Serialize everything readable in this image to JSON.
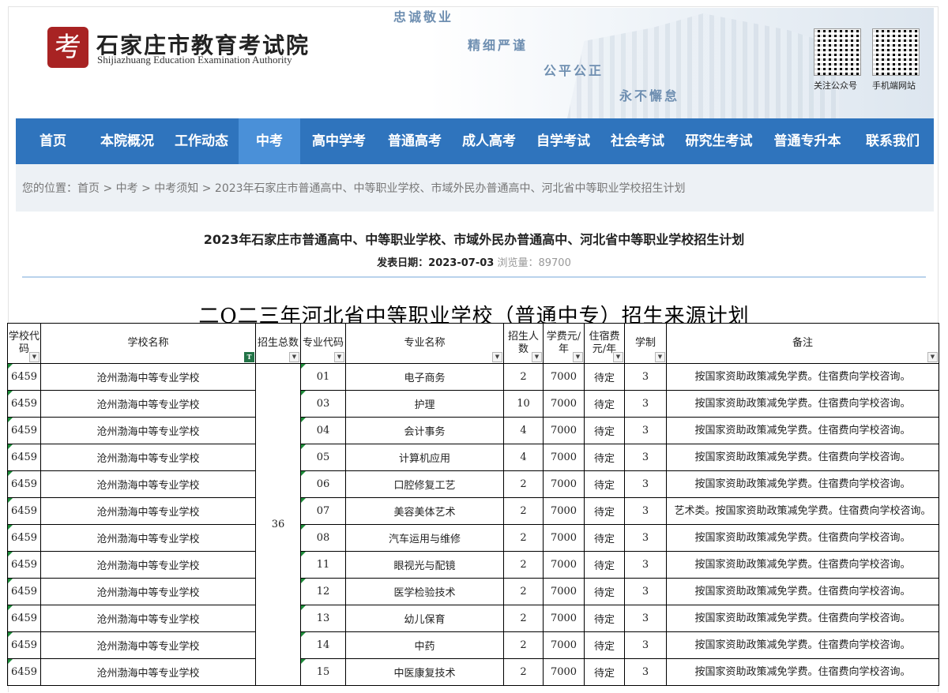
{
  "header": {
    "logo_mark": "考",
    "org_cn": "石家庄市教育考试院",
    "org_en": "Shijiazhuang Education Examination Authority",
    "slogans": [
      "忠诚敬业",
      "精细严谨",
      "公平公正",
      "永不懈怠"
    ],
    "qr_labels": [
      "关注公众号",
      "手机端网站"
    ]
  },
  "nav": {
    "items": [
      "首页",
      "本院概况",
      "工作动态",
      "中考",
      "高中学考",
      "普通高考",
      "成人高考",
      "自学考试",
      "社会考试",
      "研究生考试",
      "普通专升本",
      "联系我们"
    ],
    "active": "中考"
  },
  "breadcrumb": {
    "prefix": "您的位置：",
    "items": [
      "首页",
      "中考",
      "中考须知",
      "2023年石家庄市普通高中、中等职业学校、市域外民办普通高中、河北省中等职业学校招生计划"
    ],
    "separator": " > "
  },
  "article": {
    "title": "2023年石家庄市普通高中、中等职业学校、市域外民办普通高中、河北省中等职业学校招生计划",
    "date_label": "发表日期：",
    "date": "2023-07-03",
    "views_label": "浏览量：",
    "views": "89700"
  },
  "sheet": {
    "title": "二О二三年河北省中等职业学校（普通中专）招生来源计划",
    "headers": [
      "学校代码",
      "学校名称",
      "招生总数",
      "专业代码",
      "专业名称",
      "招生人数",
      "学费元/年",
      "住宿费元/年",
      "学制",
      "备注"
    ],
    "school_code": "6459",
    "school_name": "沧州渤海中等专业学校",
    "total": "36",
    "rows": [
      {
        "code": "01",
        "major": "电子商务",
        "count": "2",
        "tuition": "7000",
        "lodging": "待定",
        "years": "3",
        "note": "按国家资助政策减免学费。住宿费向学校咨询。"
      },
      {
        "code": "03",
        "major": "护理",
        "count": "10",
        "tuition": "7000",
        "lodging": "待定",
        "years": "3",
        "note": "按国家资助政策减免学费。住宿费向学校咨询。"
      },
      {
        "code": "04",
        "major": "会计事务",
        "count": "4",
        "tuition": "7000",
        "lodging": "待定",
        "years": "3",
        "note": "按国家资助政策减免学费。住宿费向学校咨询。"
      },
      {
        "code": "05",
        "major": "计算机应用",
        "count": "4",
        "tuition": "7000",
        "lodging": "待定",
        "years": "3",
        "note": "按国家资助政策减免学费。住宿费向学校咨询。"
      },
      {
        "code": "06",
        "major": "口腔修复工艺",
        "count": "2",
        "tuition": "7000",
        "lodging": "待定",
        "years": "3",
        "note": "按国家资助政策减免学费。住宿费向学校咨询。"
      },
      {
        "code": "07",
        "major": "美容美体艺术",
        "count": "2",
        "tuition": "7000",
        "lodging": "待定",
        "years": "3",
        "note": "艺术类。按国家资助政策减免学费。住宿费向学校咨询。"
      },
      {
        "code": "08",
        "major": "汽车运用与维修",
        "count": "2",
        "tuition": "7000",
        "lodging": "待定",
        "years": "3",
        "note": "按国家资助政策减免学费。住宿费向学校咨询。"
      },
      {
        "code": "11",
        "major": "眼视光与配镜",
        "count": "2",
        "tuition": "7000",
        "lodging": "待定",
        "years": "3",
        "note": "按国家资助政策减免学费。住宿费向学校咨询。"
      },
      {
        "code": "12",
        "major": "医学检验技术",
        "count": "2",
        "tuition": "7000",
        "lodging": "待定",
        "years": "3",
        "note": "按国家资助政策减免学费。住宿费向学校咨询。"
      },
      {
        "code": "13",
        "major": "幼儿保育",
        "count": "2",
        "tuition": "7000",
        "lodging": "待定",
        "years": "3",
        "note": "按国家资助政策减免学费。住宿费向学校咨询。"
      },
      {
        "code": "14",
        "major": "中药",
        "count": "2",
        "tuition": "7000",
        "lodging": "待定",
        "years": "3",
        "note": "按国家资助政策减免学费。住宿费向学校咨询。"
      },
      {
        "code": "15",
        "major": "中医康复技术",
        "count": "2",
        "tuition": "7000",
        "lodging": "待定",
        "years": "3",
        "note": "按国家资助政策减免学费。住宿费向学校咨询。"
      }
    ]
  },
  "colors": {
    "nav_bg": "#2f74bd",
    "nav_active": "#4a90d8",
    "logo_red": "#a82323",
    "rule": "#b9d3ec"
  }
}
